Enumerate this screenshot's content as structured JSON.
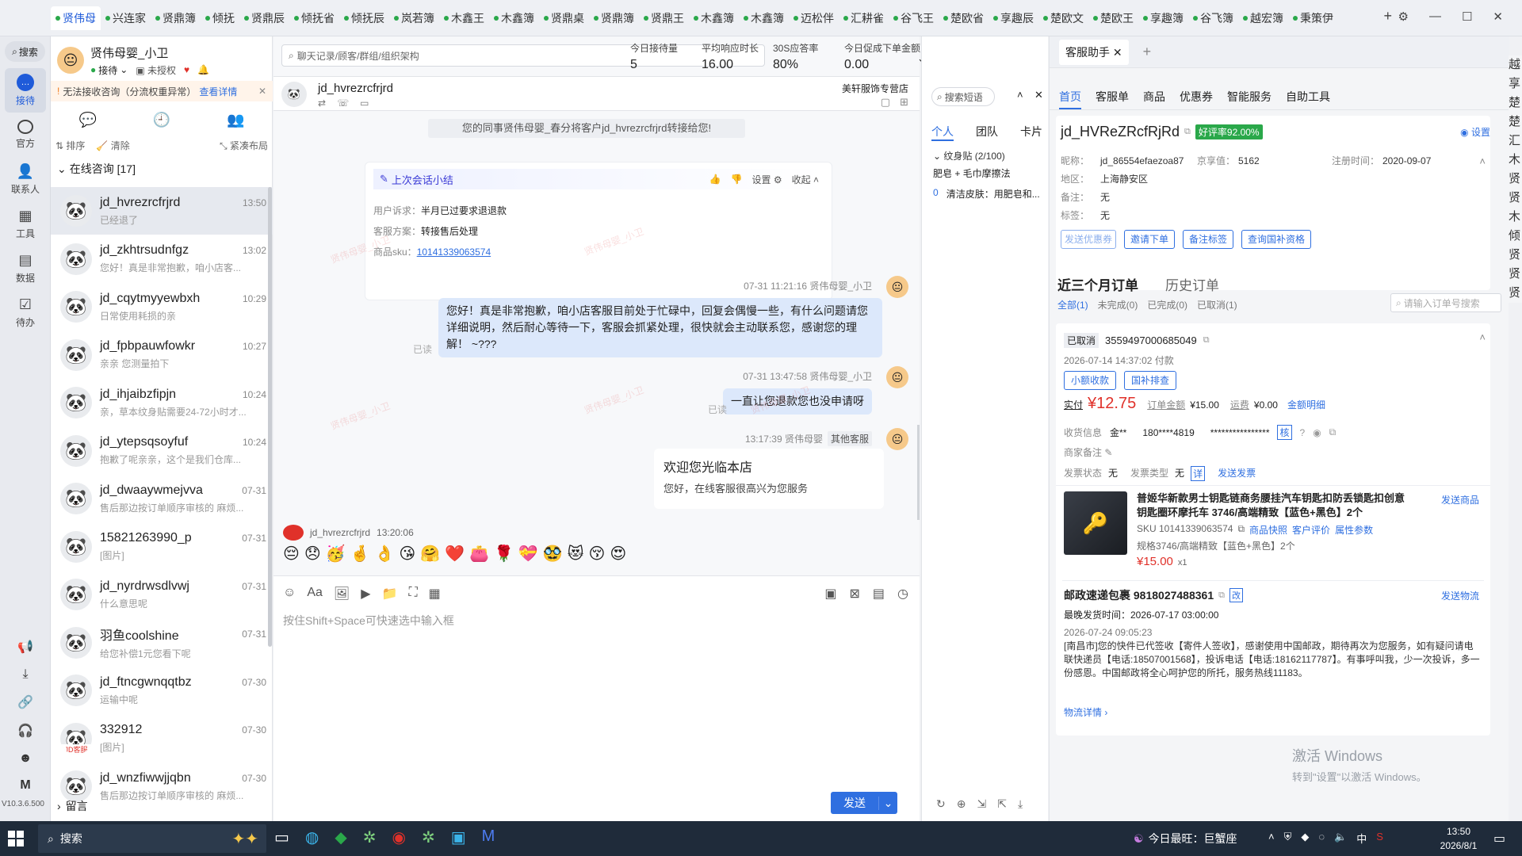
{
  "tabs": [
    {
      "label": "贤伟母"
    },
    {
      "label": "兴连家"
    },
    {
      "label": "贤鼎簿"
    },
    {
      "label": "倾抚"
    },
    {
      "label": "贤鼎辰"
    },
    {
      "label": "倾抚省"
    },
    {
      "label": "倾抚辰"
    },
    {
      "label": "岚若簿"
    },
    {
      "label": "木鑫王"
    },
    {
      "label": "木鑫簿"
    },
    {
      "label": "贤鼎桌"
    },
    {
      "label": "贤鼎簿"
    },
    {
      "label": "贤鼎王"
    },
    {
      "label": "木鑫簿"
    },
    {
      "label": "木鑫簿"
    },
    {
      "label": "迈松伴"
    },
    {
      "label": "汇耕雀"
    },
    {
      "label": "谷飞王"
    },
    {
      "label": "楚欧省"
    },
    {
      "label": "享趣辰"
    },
    {
      "label": "楚欧文"
    },
    {
      "label": "楚欧王"
    },
    {
      "label": "享趣簿"
    },
    {
      "label": "谷飞簿"
    },
    {
      "label": "越宏簿"
    },
    {
      "label": "秉策伊"
    }
  ],
  "nav": {
    "search": "搜索",
    "reception": "接待",
    "official": "官方",
    "contacts": "联系人",
    "tools": "工具",
    "data": "数据",
    "todo": "待办",
    "version": "V10.3.6.500"
  },
  "agent": {
    "name": "贤伟母婴_小卫",
    "status": "接待",
    "auth": "未授权"
  },
  "notice": {
    "text": "无法接收咨询（分流权重异常）",
    "link": "查看详情"
  },
  "list_toolbar": {
    "sort": "排序",
    "clear": "清除",
    "layout": "紧凑布局"
  },
  "online_group": "在线咨询 [17]",
  "leave_msg": "留言",
  "conversations": [
    {
      "name": "jd_hvrezrcfrjrd",
      "time": "13:50",
      "msg": "已经退了"
    },
    {
      "name": "jd_zkhtrsudnfgz",
      "time": "13:02",
      "msg": "您好！真是非常抱歉，咱小店客..."
    },
    {
      "name": "jd_cqytmyyewbxh",
      "time": "10:29",
      "msg": "日常使用耗损的亲"
    },
    {
      "name": "jd_fpbpauwfowkr",
      "time": "10:27",
      "msg": "亲亲 您测量拍下"
    },
    {
      "name": "jd_ihjaibzfipjn",
      "time": "10:24",
      "msg": "亲，草本纹身贴需要24-72小时才..."
    },
    {
      "name": "jd_ytepsqsoyfuf",
      "time": "10:24",
      "msg": "抱歉了呢亲亲，这个是我们仓库..."
    },
    {
      "name": "jd_dwaaywmejvva",
      "time": "07-31",
      "msg": "售后那边按订单顺序审核的 麻烦..."
    },
    {
      "name": "15821263990_p",
      "time": "07-31",
      "msg": "[图片]"
    },
    {
      "name": "jd_nyrdrwsdlvwj",
      "time": "07-31",
      "msg": "什么意思呢"
    },
    {
      "name": "羽鱼coolshine",
      "time": "07-31",
      "msg": "给您补偿1元您看下呢"
    },
    {
      "name": "jd_ftncgwnqqtbz",
      "time": "07-30",
      "msg": "运输中呢"
    },
    {
      "name": "332912",
      "time": "07-30",
      "msg": "[图片]",
      "badge": "JD客服"
    },
    {
      "name": "jd_wnzfiwwjjqbn",
      "time": "07-30",
      "msg": "售后那边按订单顺序审核的 麻烦..."
    }
  ],
  "search": {
    "placeholder": "聊天记录/顾客/群组/组织架构"
  },
  "stats": [
    {
      "label": "今日接待量",
      "value": "5"
    },
    {
      "label": "平均响应时长",
      "value": "16.00"
    },
    {
      "label": "30S应答率",
      "value": "80%"
    },
    {
      "label": "今日促成下单金额",
      "value": "0.00"
    }
  ],
  "chat": {
    "customer": "jd_hvrezrcfrjrd",
    "shop": "美轩服饰专营店",
    "transfer_notice": "您的同事贤伟母婴_春分将客户jd_hvrezrcfrjrd转接给您!",
    "summary": {
      "title": "上次会话小结",
      "settings": "设置",
      "collapse": "收起",
      "appeal_label": "用户诉求：",
      "appeal": "半月已过要求退退款",
      "plan_label": "客服方案：",
      "plan": "转接售后处理",
      "sku_label": "商品sku：",
      "sku": "10141339063574"
    },
    "msg1": {
      "meta": "07-31 11:21:16  贤伟母婴_小卫",
      "text": "您好！真是非常抱歉，咱小店客服目前处于忙碌中，回复会偶慢一些，有什么问题请您详细说明，然后耐心等待一下，客服会抓紧处理，很快就会主动联系您，感谢您的理解！ ~???",
      "read": "已读"
    },
    "msg2": {
      "meta": "07-31 13:47:58  贤伟母婴_小卫",
      "text": "一直让您退款您也没申请呀",
      "read": "已读"
    },
    "msg3": {
      "meta": "13:17:39  贤伟母婴",
      "tag": "其他客服",
      "title": "欢迎您光临本店",
      "text": "您好，在线客服很高兴为您服务"
    },
    "msg4": {
      "meta_name": "jd_hvrezrcfrjrd",
      "meta_time": "13:20:06",
      "emojis": "😔😞🥳🤞👌😘🤗❤️👛🌹💝🥸😻😚😍"
    },
    "watermark": "贤伟母婴_小卫",
    "input_placeholder": "按住Shift+Space可快速选中输入框",
    "send": "发送"
  },
  "quick": {
    "search": "搜索短语",
    "tabs": [
      "个人",
      "团队",
      "卡片"
    ],
    "group": "纹身贴 (2/100)",
    "items": [
      "肥皂 + 毛巾摩擦法",
      "清洁皮肤：用肥皂和..."
    ],
    "item_num": "0"
  },
  "assistant": {
    "tab": "客服助手",
    "subtabs": [
      "首页",
      "客服单",
      "商品",
      "优惠券",
      "智能服务",
      "自助工具"
    ],
    "customer_id": "jd_HVReZRcfRjRd",
    "rating": "好评率92.00%",
    "settings": "设置",
    "nick_label": "昵称：",
    "nick": "jd_86554efaezoa87",
    "score_label": "京享值：",
    "score": "5162",
    "reg_label": "注册时间：",
    "reg": "2020-09-07",
    "region_label": "地区：",
    "region": "上海静安区",
    "note_label": "备注：",
    "note": "无",
    "tag_label": "标签：",
    "tag": "无",
    "buttons": [
      "发送优惠券",
      "邀请下单",
      "备注标签",
      "查询国补资格"
    ],
    "orders_title": "近三个月订单",
    "history_title": "历史订单",
    "filters": [
      "全部(1)",
      "未完成(0)",
      "已完成(0)",
      "已取消(1)"
    ],
    "order_search": "请输入订单号搜索",
    "order": {
      "status": "已取消",
      "id": "3559497000685049",
      "time": "2026-07-14 14:37:02 付款",
      "btn1": "小额收款",
      "btn2": "国补排查",
      "paid_label": "实付",
      "paid": "¥12.75",
      "amount_label": "订单金额",
      "amount": "¥15.00",
      "freight_label": "运费",
      "freight": "¥0.00",
      "detail": "金额明细",
      "recv_label": "收货信息",
      "recv_name": "金**",
      "recv_phone": "180****4819",
      "recv_addr": "****************",
      "check": "核",
      "remark_label": "商家备注",
      "ship_label": "发票状态",
      "ship_val": "无",
      "inv_label": "发票类型",
      "inv_val": "无",
      "inv_detail": "详",
      "send_inv": "发送发票",
      "product": "普姬华新款男士钥匙链商务腰挂汽车钥匙扣防丢锁匙扣创意钥匙圈环摩托车 3746/高端精致【蓝色+黑色】2个",
      "send_product": "发送商品",
      "sku": "SKU 10141339063574",
      "p_links": [
        "商品快照",
        "客户评价",
        "属性参数"
      ],
      "spec": "规格3746/高端精致【蓝色+黑色】2个",
      "price": "¥15.00",
      "qty": "x1"
    },
    "logistics": {
      "title": "邮政速递包裹 9818027488361",
      "change": "改",
      "send": "发送物流",
      "latest": "最晚发货时间：2026-07-17 03:00:00",
      "time": "2026-07-24 09:05:23",
      "text": "[南昌市]您的快件已代签收【寄件人签收】，感谢使用中国邮政，期待再次为您服务，如有疑问请电联快递员【电话:18507001568】，投诉电话【电话:18162117787】。有事呼叫我，少一次投诉，多一份感恩。中国邮政将全心呵护您的所托，服务热线11183。",
      "detail": "物流详情"
    },
    "win_watermark1": "激活 Windows",
    "win_watermark2": "转到\"设置\"以激活 Windows。"
  },
  "edge_chars": [
    "越",
    "享",
    "楚",
    "楚",
    "汇",
    "木",
    "贤",
    "贤",
    "木",
    "倾",
    "贤",
    "贤",
    "贤"
  ],
  "taskbar": {
    "search": "搜索",
    "weather": "今日最旺：巨蟹座",
    "time": "13:50",
    "date": "2026/8/1",
    "ime": "中"
  },
  "colors": {
    "accent": "#2f6fe0",
    "green": "#2aa84a",
    "red": "#e0312a",
    "bubble": "#dce8fb"
  }
}
